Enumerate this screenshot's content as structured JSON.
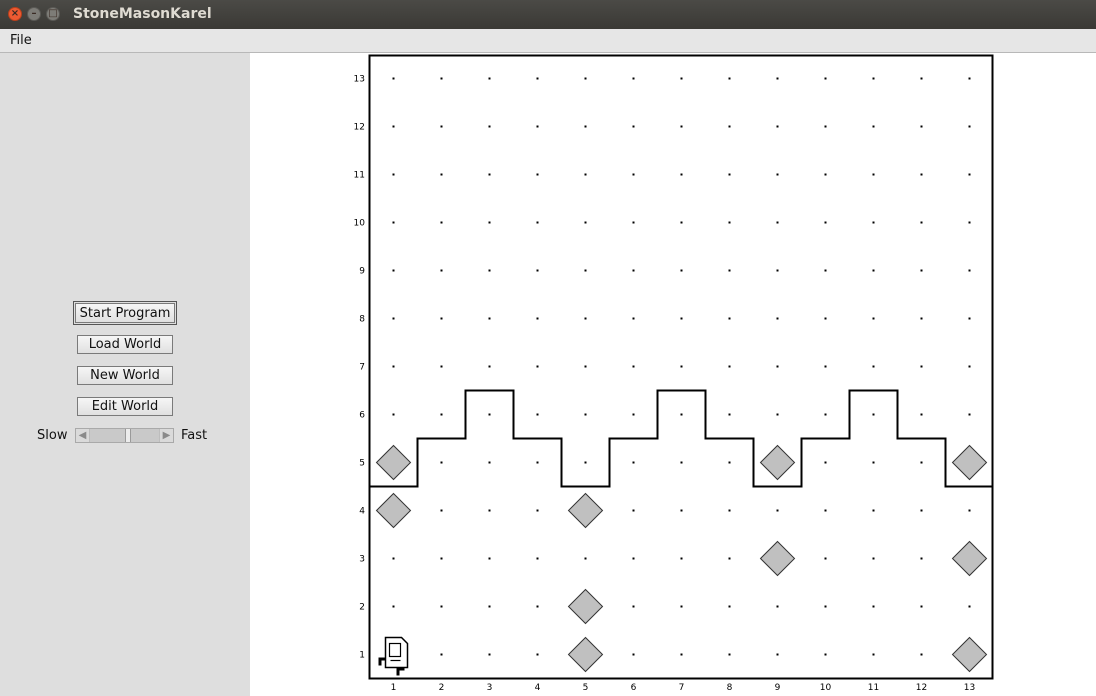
{
  "window": {
    "title": "StoneMasonKarel"
  },
  "menubar": {
    "file_label": "File"
  },
  "controls": {
    "start_label": "Start Program",
    "load_label": "Load World",
    "new_label": "New World",
    "edit_label": "Edit World",
    "slow_label": "Slow",
    "fast_label": "Fast",
    "speed_level": 0.56
  },
  "world": {
    "columns": 13,
    "rows": 13,
    "x_labels": [
      "1",
      "2",
      "3",
      "4",
      "5",
      "6",
      "7",
      "8",
      "9",
      "10",
      "11",
      "12",
      "13"
    ],
    "y_labels": [
      "1",
      "2",
      "3",
      "4",
      "5",
      "6",
      "7",
      "8",
      "9",
      "10",
      "11",
      "12",
      "13"
    ],
    "beepers": [
      [
        1,
        5
      ],
      [
        1,
        4
      ],
      [
        5,
        4
      ],
      [
        5,
        2
      ],
      [
        5,
        1
      ],
      [
        9,
        5
      ],
      [
        9,
        3
      ],
      [
        13,
        5
      ],
      [
        13,
        3
      ],
      [
        13,
        1
      ]
    ],
    "wall_profile_heights": [
      5,
      6,
      7,
      6,
      5,
      6,
      7,
      6,
      5,
      6,
      7,
      6,
      5
    ],
    "karel": {
      "avenue": 1,
      "street": 1,
      "facing": "east"
    },
    "beeper_color": "#c0c0c0"
  }
}
